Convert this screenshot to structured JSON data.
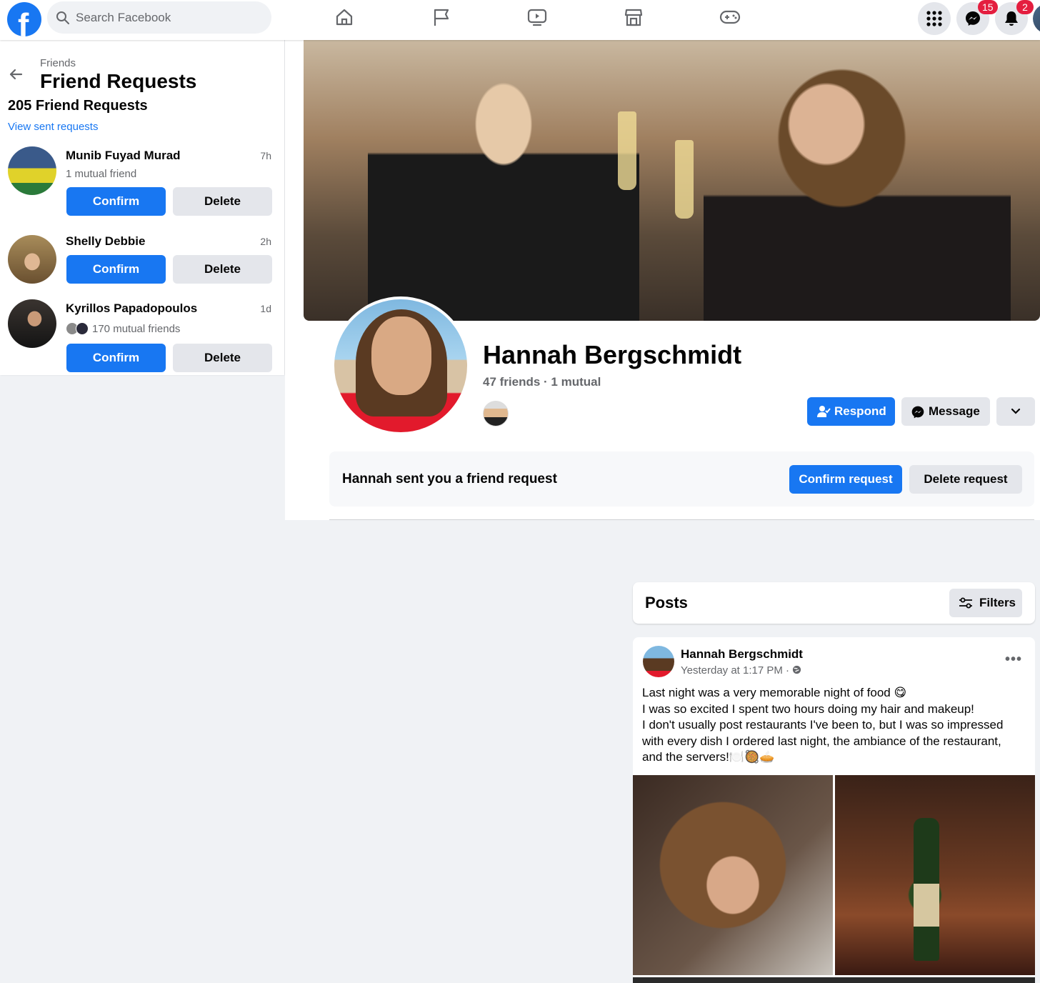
{
  "topbar": {
    "logo_letter": "f",
    "search_placeholder": "Search Facebook",
    "nav_icons": [
      "home-icon",
      "flag-icon",
      "watch-icon",
      "marketplace-icon",
      "gaming-icon"
    ],
    "right_icons": [
      "menu-grid-icon",
      "messenger-icon",
      "bell-icon"
    ],
    "messenger_badge": "15",
    "notifications_badge": "2"
  },
  "left_panel": {
    "crumb": "Friends",
    "title": "Friend Requests",
    "count": "205 Friend Requests",
    "view_sent": "View sent requests",
    "requests": [
      {
        "name": "Munib Fuyad Murad",
        "time": "7h",
        "mutual": "1 mutual friend",
        "confirm": "Confirm",
        "delete": "Delete"
      },
      {
        "name": "Shelly Debbie",
        "time": "2h",
        "mutual": "",
        "confirm": "Confirm",
        "delete": "Delete"
      },
      {
        "name": "Kyrillos Papadopoulos",
        "time": "1d",
        "mutual": "170 mutual friends",
        "confirm": "Confirm",
        "delete": "Delete"
      }
    ]
  },
  "profile": {
    "name": "Hannah Bergschmidt",
    "friends": "47 friends · 1 mutual",
    "respond": "Respond",
    "message": "Message",
    "request_msg": "Hannah sent you a friend request",
    "confirm_request": "Confirm request",
    "delete_request": "Delete request"
  },
  "posts": {
    "header": "Posts",
    "filters": "Filters",
    "post": {
      "author": "Hannah Bergschmidt",
      "time": "Yesterday at 1:17 PM ·",
      "more": "•••",
      "lines": [
        "Last night was a very memorable night of food 😋",
        "I was so excited I spent two hours doing my hair and makeup!",
        "I don't usually post restaurants I've been to, but I was so impressed",
        "with every dish I ordered last night, the ambiance of the restaurant,",
        "and the servers!🍽️🥘🥧"
      ]
    }
  },
  "colors": {
    "brand": "#1877f2",
    "badge": "#e41e3f",
    "background": "#f0f2f5"
  }
}
